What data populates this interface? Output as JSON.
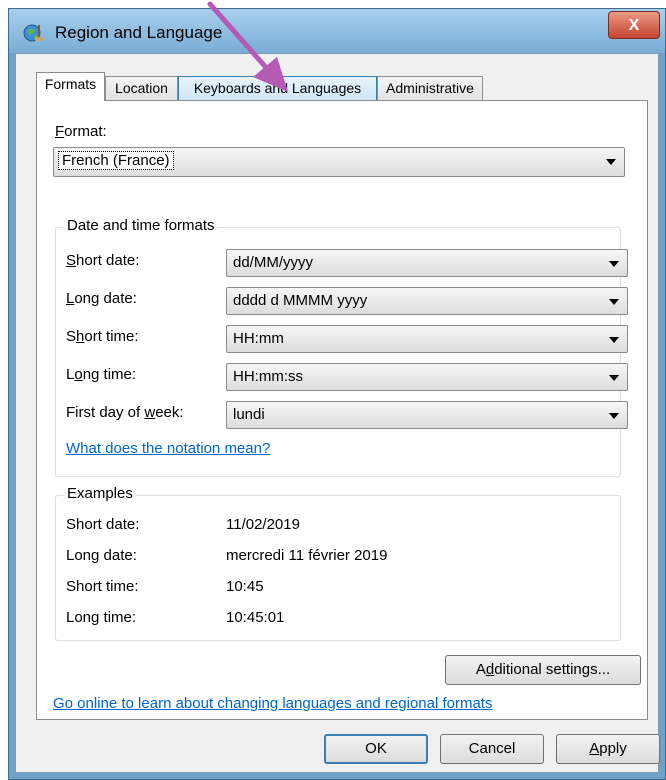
{
  "window": {
    "title": "Region and Language",
    "close_glyph": "X"
  },
  "tabs": [
    {
      "label": "Formats",
      "active": true
    },
    {
      "label": "Location",
      "active": false
    },
    {
      "label": "Keyboards and Languages",
      "active": false
    },
    {
      "label": "Administrative",
      "active": false
    }
  ],
  "format": {
    "label_key": "F",
    "label_rest": "ormat:",
    "value": "French (France)"
  },
  "date_time_formats": {
    "title": "Date and time formats",
    "rows": [
      {
        "label_pre": "",
        "label_key": "S",
        "label_post": "hort date:",
        "value": "dd/MM/yyyy"
      },
      {
        "label_pre": "",
        "label_key": "L",
        "label_post": "ong date:",
        "value": "dddd d MMMM yyyy"
      },
      {
        "label_pre": "S",
        "label_key": "h",
        "label_post": "ort time:",
        "value": "HH:mm"
      },
      {
        "label_pre": "L",
        "label_key": "o",
        "label_post": "ng time:",
        "value": "HH:mm:ss"
      },
      {
        "label_pre": "First day of ",
        "label_key": "w",
        "label_post": "eek:",
        "value": "lundi"
      }
    ],
    "notation_link": "What does the notation mean?"
  },
  "examples": {
    "title": "Examples",
    "rows": [
      {
        "label": "Short date:",
        "value": "11/02/2019"
      },
      {
        "label": "Long date:",
        "value": "mercredi 11 février 2019"
      },
      {
        "label": "Short time:",
        "value": "10:45"
      },
      {
        "label": "Long time:",
        "value": "10:45:01"
      }
    ]
  },
  "additional_settings": {
    "pre": "A",
    "key": "d",
    "post": "ditional settings..."
  },
  "online_link": "Go online to learn about changing languages and regional formats",
  "buttons": {
    "ok": "OK",
    "cancel": "Cancel",
    "apply_key": "A",
    "apply_rest": "pply"
  },
  "colors": {
    "annotation_arrow": "#b45ab4",
    "link": "#0066cc",
    "title_bar": "#8fbde2",
    "close_button": "#c64330"
  },
  "icons": {
    "app": "globe-icon",
    "close": "close-icon",
    "dropdown": "chevron-down-icon",
    "annotation": "arrow-annotation-icon"
  }
}
